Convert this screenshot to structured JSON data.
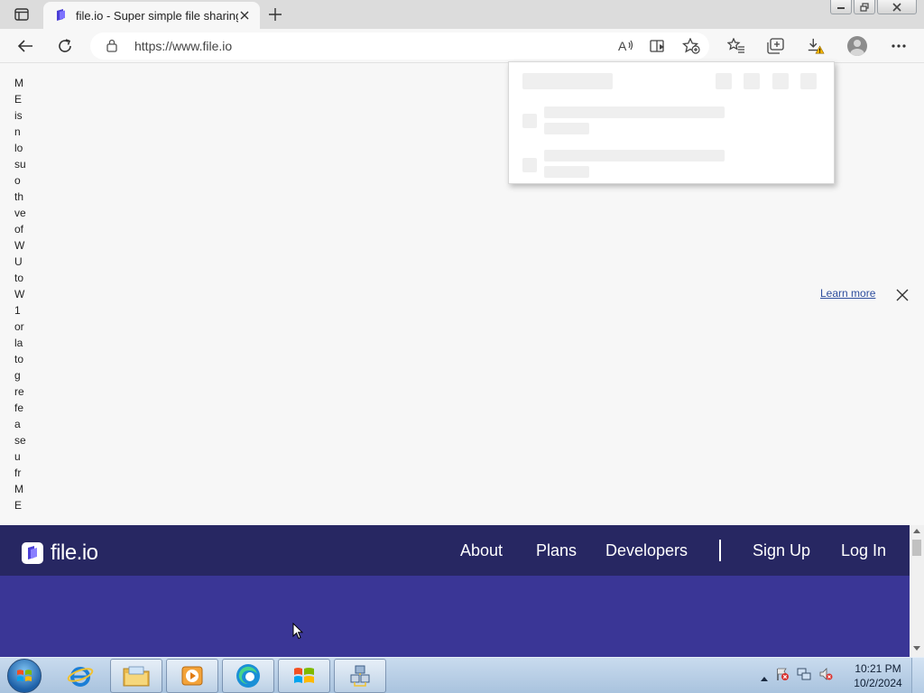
{
  "browser": {
    "tab_title": "file.io - Super simple file sharing",
    "url": "https://www.file.io"
  },
  "page": {
    "notice_fragments": [
      "M",
      "E",
      "is",
      "n",
      "lo",
      "su",
      "o",
      "th",
      "ve",
      "of",
      "W",
      "U",
      "to",
      "W",
      "1",
      "or",
      "la",
      "to",
      "g",
      "re",
      "fe",
      "a",
      "se",
      "u",
      "fr",
      "M",
      "E"
    ],
    "learn_more": "Learn more"
  },
  "site": {
    "brand": "file.io",
    "nav": {
      "about": "About",
      "plans": "Plans",
      "developers": "Developers",
      "sign_up": "Sign Up",
      "log_in": "Log In"
    },
    "colors": {
      "nav_bg": "#272762",
      "hero_bg": "#3a3696",
      "accent": "#6a5cff"
    }
  },
  "taskbar": {
    "time": "10:21 PM",
    "date": "10/2/2024"
  }
}
